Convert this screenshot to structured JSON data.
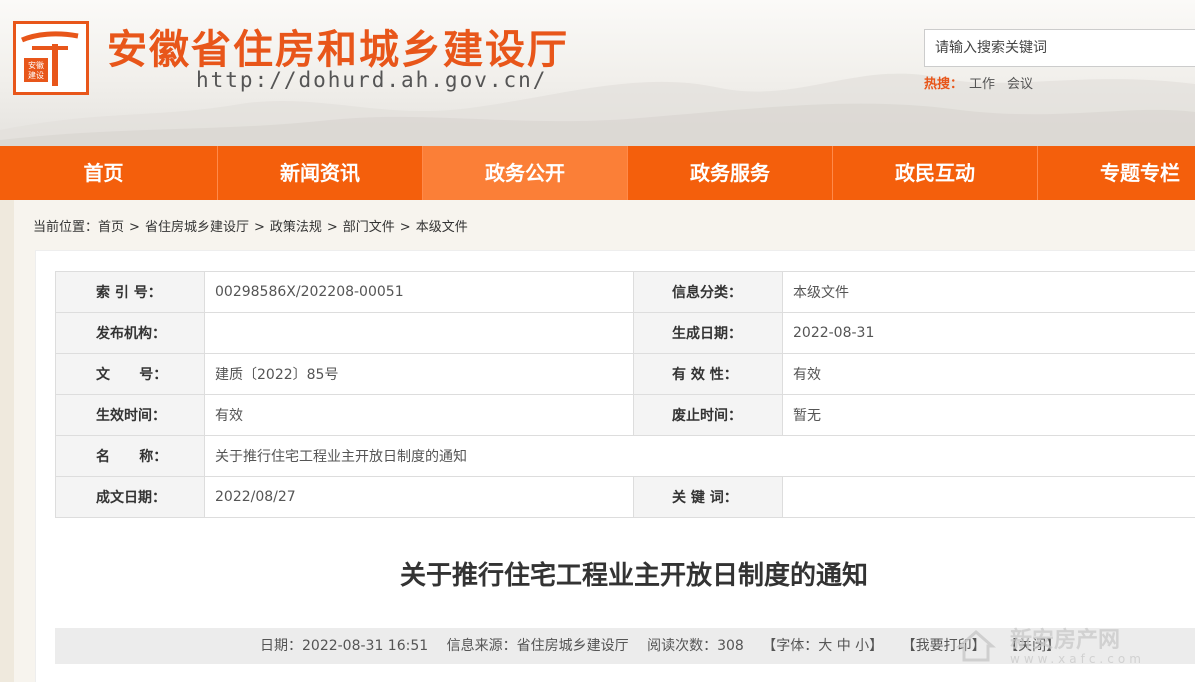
{
  "header": {
    "site_title": "安徽省住房和城乡建设厅",
    "site_url": "http://dohurd.ah.gov.cn/",
    "logo_text": "安徽建设",
    "search_placeholder": "请输入搜索关键词",
    "hot_label": "热搜：",
    "hot_items": [
      "工作",
      "会议"
    ]
  },
  "nav": {
    "items": [
      "首页",
      "新闻资讯",
      "政务公开",
      "政务服务",
      "政民互动",
      "专题专栏"
    ],
    "active_index": 2
  },
  "breadcrumb": {
    "prefix": "当前位置：",
    "items": [
      "首页",
      "省住房城乡建设厅",
      "政策法规",
      "部门文件",
      "本级文件"
    ],
    "separator": ">"
  },
  "meta": {
    "rows": [
      {
        "l1": "索 引 号：",
        "v1": "00298586X/202208-00051",
        "l2": "信息分类：",
        "v2": "本级文件"
      },
      {
        "l1": "发布机构：",
        "v1": "",
        "l2": "生成日期：",
        "v2": "2022-08-31"
      },
      {
        "l1": "文      号：",
        "v1": "建质〔2022〕85号",
        "l2": "有 效 性：",
        "v2": "有效"
      },
      {
        "l1": "生效时间：",
        "v1": "有效",
        "l2": "废止时间：",
        "v2": "暂无"
      },
      {
        "l1": "名      称：",
        "v1": "关于推行住宅工程业主开放日制度的通知"
      },
      {
        "l1": "成文日期：",
        "v1": "2022/08/27",
        "l2": "关 键 词：",
        "v2": ""
      }
    ]
  },
  "document": {
    "title": "关于推行住宅工程业主开放日制度的通知",
    "date": "日期：2022-08-31 16:51",
    "source": "信息来源：省住房城乡建设厅",
    "views": "阅读次数：308",
    "font_size": "【字体：大 中 小】",
    "print": "【我要打印】",
    "close": "【关闭】"
  },
  "watermark": {
    "main": "新安房产网",
    "sub": "www.xafc.com"
  },
  "colors": {
    "accent": "#f45f0c",
    "nav_active": "#fb7f37",
    "title": "#e8561a"
  }
}
